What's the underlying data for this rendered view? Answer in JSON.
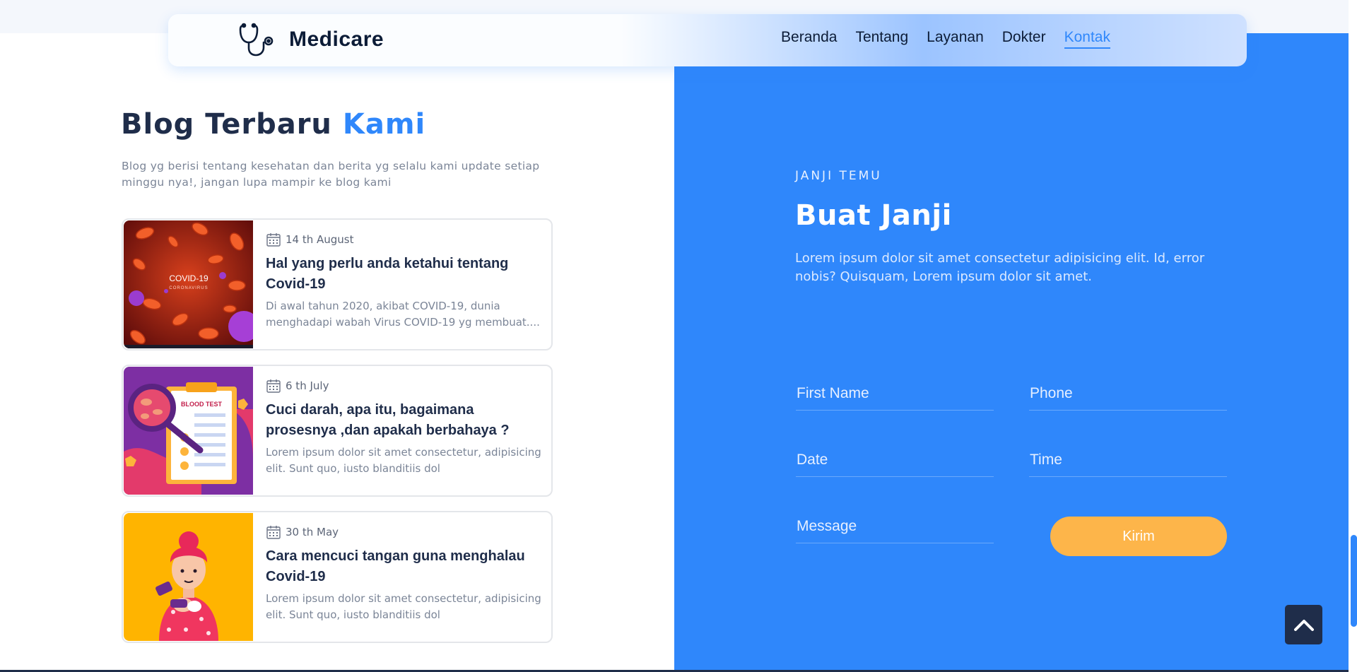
{
  "navbar": {
    "brand": "Medicare",
    "links": [
      "Beranda",
      "Tentang",
      "Layanan",
      "Dokter",
      "Kontak"
    ],
    "active": "Kontak"
  },
  "blog": {
    "title_main": "Blog Terbaru",
    "title_accent": "Kami",
    "description": "Blog yg berisi tentang kesehatan dan berita yg selalu kami update setiap minggu nya!, jangan lupa mampir ke blog kami",
    "posts": [
      {
        "date": "14 th August",
        "title": "Hal yang perlu anda ketahui tentang Covid-19",
        "excerpt": "Di awal tahun 2020, akibat COVID-19, dunia menghadapi wabah Virus COVID-19 yg membuat....",
        "image_text": "COVID-19",
        "image_subtext": "CORONAVIRUS"
      },
      {
        "date": "6 th July",
        "title": "Cuci darah, apa itu, bagaimana prosesnya ,dan apakah berbahaya ?",
        "excerpt": "Lorem ipsum dolor sit amet consectetur, adipisicing elit. Sunt quo, iusto blanditiis dol",
        "image_text": "BLOOD TEST"
      },
      {
        "date": "30 th May",
        "title": "Cara mencuci tangan guna menghalau Covid-19",
        "excerpt": "Lorem ipsum dolor sit amet consectetur, adipisicing elit. Sunt quo, iusto blanditiis dol"
      }
    ]
  },
  "appointment": {
    "eyebrow": "JANJI TEMU",
    "title": "Buat Janji",
    "description": "Lorem ipsum dolor sit amet consectetur adipisicing elit. Id, error nobis? Quisquam, Lorem ipsum dolor sit amet.",
    "fields": {
      "first_name": "First Name",
      "phone": "Phone",
      "date": "Date",
      "time": "Time",
      "message": "Message"
    },
    "submit": "Kirim"
  },
  "colors": {
    "accent": "#2f87fb",
    "dark": "#1f2d4a",
    "button": "#fdb54a"
  },
  "icons": [
    "stethoscope-icon",
    "calendar-icon",
    "chevron-up-icon"
  ]
}
